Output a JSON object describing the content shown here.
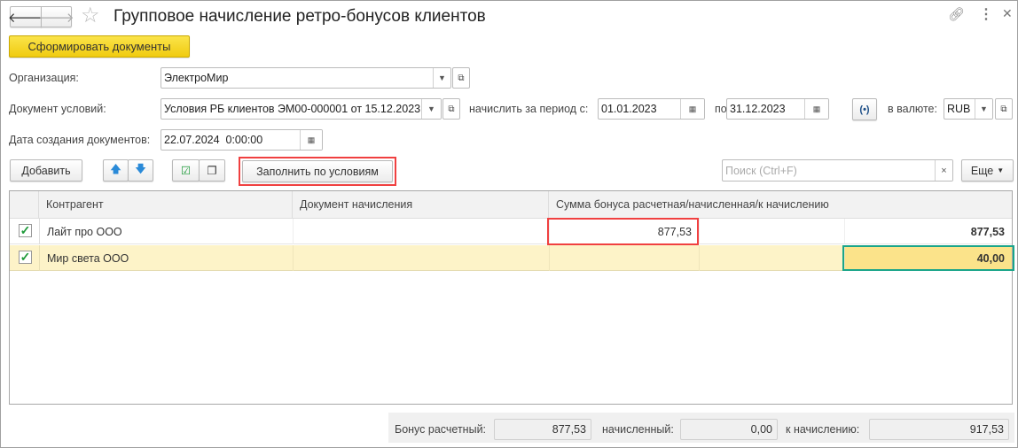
{
  "window": {
    "title": "Групповое начисление ретро-бонусов клиентов"
  },
  "nav": {
    "back_icon": "arrow-left-icon",
    "forward_icon": "arrow-right-icon",
    "favorite_icon": "star-icon"
  },
  "header_actions": {
    "link_icon": "link-icon",
    "more_icon": "more-vertical-icon",
    "close_icon": "close-icon"
  },
  "actions": {
    "create_documents": "Сформировать документы"
  },
  "form": {
    "organization": {
      "label": "Организация:",
      "value": "ЭлектроМир"
    },
    "conditions_doc": {
      "label": "Документ условий:",
      "value": "Условия РБ клиентов ЭМ00-000001 от 15.12.2023"
    },
    "period_from": {
      "label": "начислить за период с:",
      "value": "01.01.2023"
    },
    "period_to": {
      "label": "по:",
      "value": "31.12.2023"
    },
    "currency": {
      "label": "в валюте:",
      "value": "RUB"
    },
    "creation_date": {
      "label": "Дата создания документов:",
      "value": "22.07.2024  0:00:00"
    }
  },
  "toolbar": {
    "add": "Добавить",
    "fill_by_conditions": "Заполнить по условиям",
    "search_placeholder": "Поиск (Ctrl+F)",
    "more": "Еще"
  },
  "table": {
    "columns": [
      "Контрагент",
      "Документ начисления",
      "Сумма бонуса расчетная/начисленная/к начислению"
    ],
    "rows": [
      {
        "checked": true,
        "counterparty": "Лайт про ООО",
        "document": "",
        "calculated": "877,53",
        "accrued": "",
        "to_accrue": "877,53"
      },
      {
        "checked": true,
        "counterparty": "Мир света ООО",
        "document": "",
        "calculated": "",
        "accrued": "",
        "to_accrue": "40,00"
      }
    ]
  },
  "totals": {
    "calculated_label": "Бонус расчетный:",
    "calculated": "877,53",
    "accrued_label": "начисленный:",
    "accrued": "0,00",
    "to_accrue_label": "к начислению:",
    "to_accrue": "917,53"
  },
  "colors": {
    "primary_button": "#f5d31a",
    "selected_row": "#fdf3c8",
    "highlight_red": "#f04040",
    "highlight_green": "#1aa58a"
  }
}
